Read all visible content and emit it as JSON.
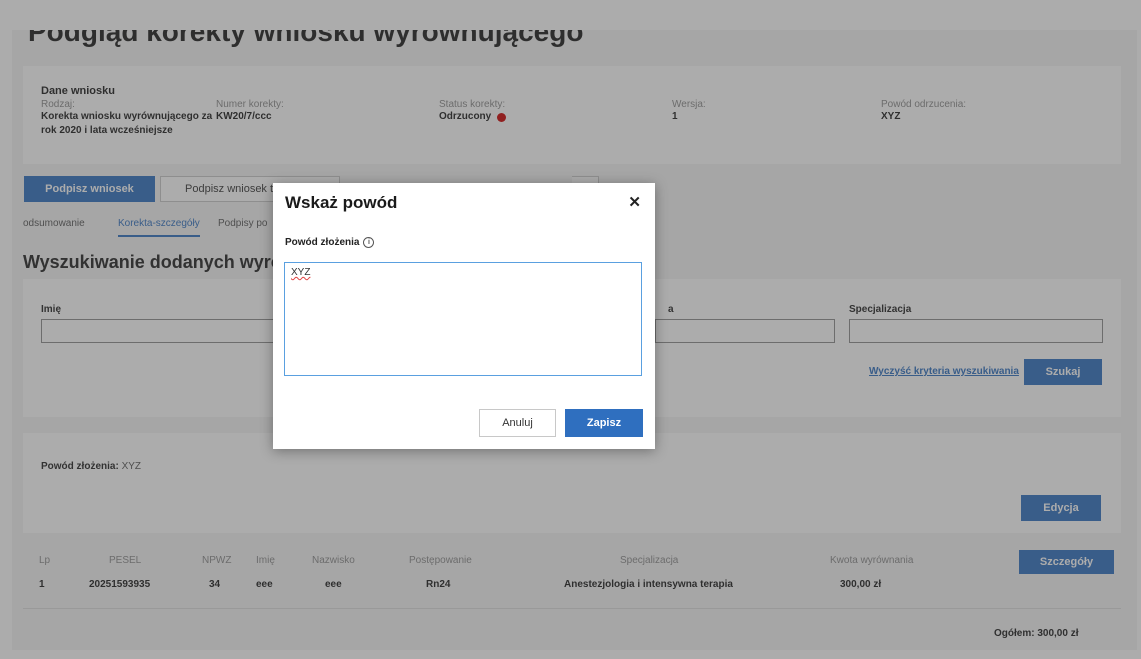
{
  "page": {
    "title": "Podgląd korekty wniosku wyrównującego"
  },
  "application": {
    "section_title": "Dane wniosku",
    "fields": [
      {
        "label": "Rodzaj:",
        "value_lines": [
          "Korekta wniosku wyrównującego za",
          "rok 2020 i lata wcześniejsze"
        ]
      },
      {
        "label": "Numer korekty:",
        "value_lines": [
          "KW20/7/ccc"
        ]
      },
      {
        "label": "Status korekty:",
        "value_lines": [
          "Odrzucony"
        ],
        "status_color": "#cc0000"
      },
      {
        "label": "Wersja:",
        "value_lines": [
          "1"
        ]
      },
      {
        "label": "Powód odrzucenia:",
        "value_lines": [
          "XYZ"
        ]
      }
    ]
  },
  "actions": {
    "sign_label": "Podpisz wniosek",
    "sign_other_label": "Podpisz wniosek t"
  },
  "tabs": [
    {
      "label": "odsumowanie",
      "active": false
    },
    {
      "label": "Korekta-szczegóły",
      "active": true
    },
    {
      "label": "Podpisy po",
      "active": false
    }
  ],
  "search": {
    "heading": "Wyszukiwanie dodanych wyrów",
    "fields": {
      "first_name_label": "Imię",
      "partial_label": "a",
      "specialization_label": "Specjalizacja"
    },
    "clear_label": "Wyczyść kryteria wyszukiwania",
    "search_label": "Szukaj"
  },
  "reason": {
    "label": "Powód złożenia:",
    "value": "XYZ",
    "edit_label": "Edycja"
  },
  "table": {
    "headers": [
      "Lp",
      "PESEL",
      "NPWZ",
      "Imię",
      "Nazwisko",
      "Postępowanie",
      "Specjalizacja",
      "Kwota wyrównania"
    ],
    "details_label": "Szczegóły",
    "rows": [
      [
        "1",
        "20251593935",
        "34",
        "eee",
        "eee",
        "Rn24",
        "Anestezjologia i intensywna terapia",
        "300,00 zł"
      ]
    ],
    "total": "Ogółem: 300,00 zł"
  },
  "modal": {
    "title": "Wskaż powód",
    "close_icon": "close-icon",
    "field_label": "Powód złożenia",
    "textarea_value": "XYZ",
    "cancel_label": "Anuluj",
    "save_label": "Zapisz"
  },
  "colors": {
    "primary": "#2f6fbf",
    "status_rejected": "#cc0000",
    "textarea_focus": "#5aa0e0"
  }
}
